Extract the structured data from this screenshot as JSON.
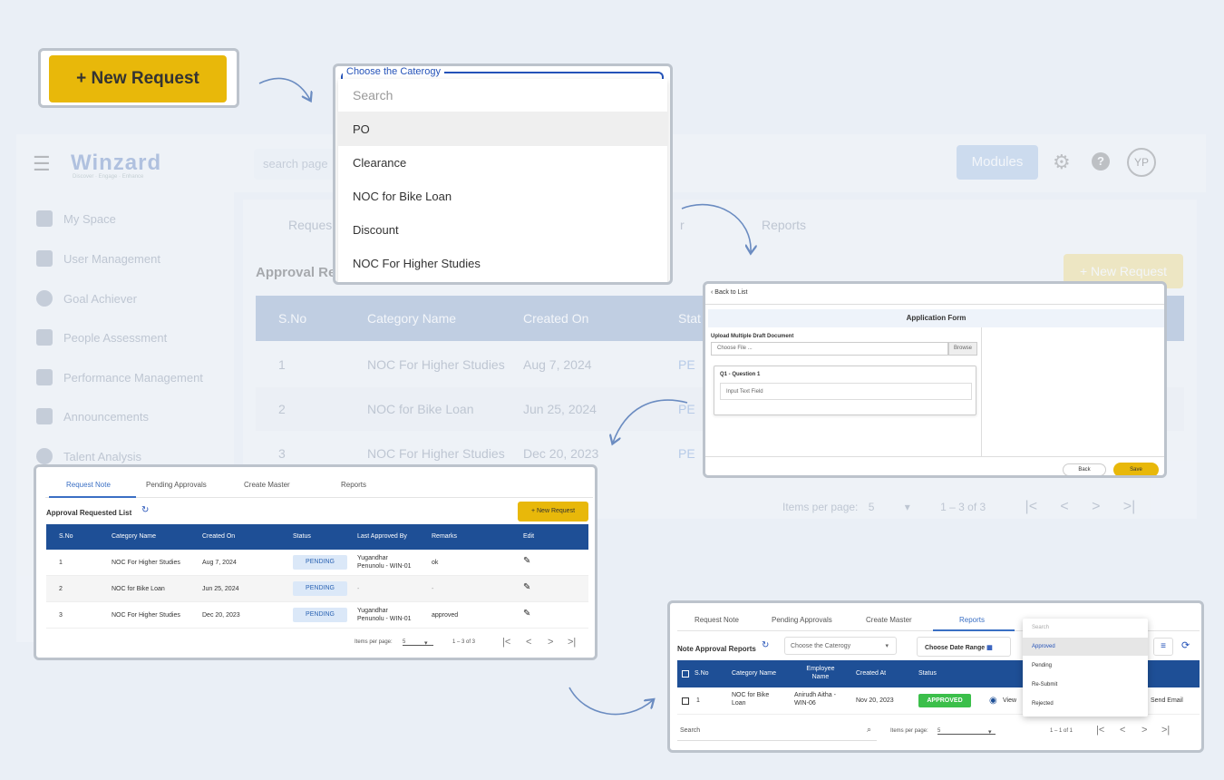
{
  "background_app": {
    "logo": "Winzard",
    "logo_tagline": "Discover · Engage · Enhance",
    "search_placeholder": "search page",
    "modules_label": "Modules",
    "avatar_initials": "YP",
    "sidebar": [
      {
        "label": "My Space"
      },
      {
        "label": "User Management"
      },
      {
        "label": "Goal Achiever"
      },
      {
        "label": "People Assessment"
      },
      {
        "label": "Performance Management"
      },
      {
        "label": "Announcements"
      },
      {
        "label": "Talent Analysis"
      }
    ],
    "tabs": [
      "Reques",
      "r",
      "Reports"
    ],
    "title": "Approval Re",
    "new_request": "+ New Request",
    "columns": [
      "S.No",
      "Category Name",
      "Created On",
      "Stat"
    ],
    "rows": [
      {
        "sno": "1",
        "category": "NOC For Higher Studies",
        "created": "Aug 7, 2024",
        "status": "PE"
      },
      {
        "sno": "2",
        "category": "NOC for Bike Loan",
        "created": "Jun 25, 2024",
        "status": "PE"
      },
      {
        "sno": "3",
        "category": "NOC For Higher Studies",
        "created": "Dec 20, 2023",
        "status": "PE"
      }
    ],
    "pager": {
      "items_label": "Items per page:",
      "per_page": "5",
      "range": "1 – 3 of 3"
    }
  },
  "new_request_button": {
    "label": "+ New Request"
  },
  "category_dropdown": {
    "label": "Choose the Caterogy",
    "search_placeholder": "Search",
    "options": [
      "PO",
      "Clearance",
      "NOC for Bike Loan",
      "Discount",
      "NOC For Higher Studies"
    ],
    "highlighted": "PO"
  },
  "application_form": {
    "back_label": "Back to List",
    "title": "Application Form",
    "upload_label": "Upload Multiple Draft Document",
    "file_placeholder": "Choose File ...",
    "browse_label": "Browse",
    "question_title": "Q1 - Question 1",
    "question_placeholder": "Input Text Field",
    "back_button": "Back",
    "save_button": "Save"
  },
  "request_list": {
    "tabs": [
      "Request Note",
      "Pending Approvals",
      "Create Master",
      "Reports"
    ],
    "active_tab": "Request Note",
    "title": "Approval Requested List",
    "new_request": "+ New Request",
    "columns": [
      "S.No",
      "Category Name",
      "Created On",
      "Status",
      "Last Approved By",
      "Remarks",
      "Edit"
    ],
    "rows": [
      {
        "sno": "1",
        "category": "NOC For Higher Studies",
        "created": "Aug 7, 2024",
        "status": "PENDING",
        "approved_by_1": "Yugandhar",
        "approved_by_2": "Penunolu - WIN-01",
        "remarks": "ok"
      },
      {
        "sno": "2",
        "category": "NOC for Bike Loan",
        "created": "Jun 25, 2024",
        "status": "PENDING",
        "approved_by_1": "-",
        "approved_by_2": "",
        "remarks": "-"
      },
      {
        "sno": "3",
        "category": "NOC For Higher Studies",
        "created": "Dec 20, 2023",
        "status": "PENDING",
        "approved_by_1": "Yugandhar",
        "approved_by_2": "Penunolu - WIN-01",
        "remarks": "approved"
      }
    ],
    "pager": {
      "items_label": "Items per page:",
      "per_page": "5",
      "range": "1 – 3 of 3"
    }
  },
  "reports": {
    "tabs": [
      "Request Note",
      "Pending Approvals",
      "Create Master",
      "Reports"
    ],
    "active_tab": "Reports",
    "title": "Note Approval Reports",
    "category_select": "Choose the Caterogy",
    "date_range": "Choose Date Range",
    "columns": [
      "S.No",
      "Category Name",
      "Employee",
      "Name",
      "Created At",
      "Status"
    ],
    "row": {
      "sno": "1",
      "category_1": "NOC for Bike",
      "category_2": "Loan",
      "employee_1": "Anirudh Aitha -",
      "employee_2": "WIN-06",
      "created": "Nov 20, 2023",
      "status": "APPROVED",
      "view": "View",
      "send_email": "Send Email"
    },
    "search_label": "Search",
    "pager": {
      "items_label": "Items per page:",
      "per_page": "5",
      "range": "1 – 1 of 1"
    },
    "status_dropdown": {
      "search_placeholder": "Search",
      "options": [
        "Approved",
        "Pending",
        "Re-Submit",
        "Rejected"
      ],
      "selected": "Approved"
    }
  },
  "colors": {
    "accent_yellow": "#e8b80a",
    "header_blue": "#1e4f96",
    "link_blue": "#2452b8",
    "approved_green": "#3bbf4a"
  }
}
